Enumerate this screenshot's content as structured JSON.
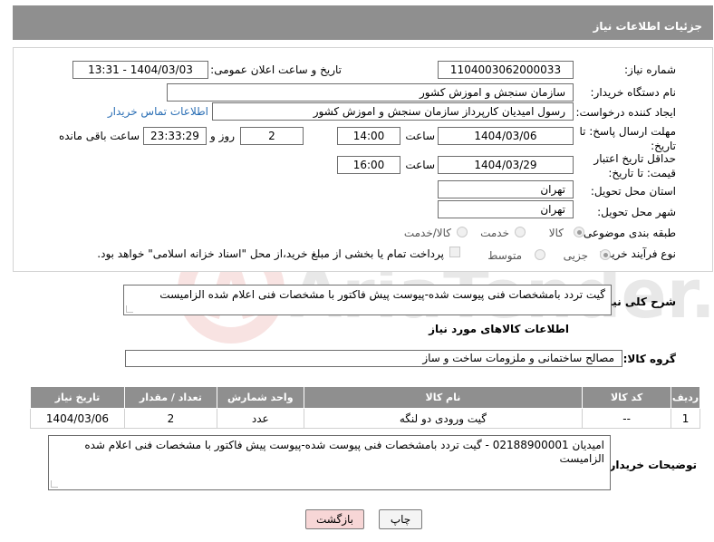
{
  "header": {
    "title": "جزئیات اطلاعات نیاز"
  },
  "form": {
    "need_number_label": "شماره نیاز:",
    "need_number": "1104003062000033",
    "announce_label": "تاریخ و ساعت اعلان عمومی:",
    "announce_value": "1404/03/03 - 13:31",
    "buyer_org_label": "نام دستگاه خریدار:",
    "buyer_org": "سازمان سنجش و اموزش کشور",
    "requester_label": "ایجاد کننده درخواست:",
    "requester": "رسول امیدیان کارپرداز سازمان سنجش و اموزش کشور",
    "contact_link": "اطلاعات تماس خریدار",
    "reply_deadline_label": "مهلت ارسال پاسخ: تا تاریخ:",
    "reply_date": "1404/03/06",
    "time_label": "ساعت",
    "reply_time": "14:00",
    "days_value": "2",
    "days_label": "روز و",
    "remaining_time": "23:33:29",
    "remaining_label": "ساعت باقی مانده",
    "price_validity_label": "حداقل تاریخ اعتبار قیمت: تا تاریخ:",
    "price_date": "1404/03/29",
    "price_time": "16:00",
    "province_label": "استان محل تحویل:",
    "province": "تهران",
    "city_label": "شهر محل تحویل:",
    "city": "تهران",
    "category_label": "طبقه بندی موضوعی:",
    "category_options": [
      "کالا",
      "خدمت",
      "کالا/خدمت"
    ],
    "category_selected": "کالا",
    "process_label": "نوع فرآیند خرید :",
    "process_options": [
      "جزیی",
      "متوسط"
    ],
    "process_selected": "جزیی",
    "payment_note": "پرداخت تمام یا بخشی از مبلغ خرید،از محل \"اسناد خزانه اسلامی\" خواهد بود."
  },
  "description": {
    "label": "شرح کلی نیاز:",
    "text": "گیت تردد بامشخصات فنی پیوست شده-پیوست پیش فاکتور با مشخصات فنی اعلام شده الزامیست"
  },
  "goods": {
    "section_title": "اطلاعات کالاهای مورد نیاز",
    "group_label": "گروه کالا:",
    "group_value": "مصالح ساختمانی و ملزومات ساخت و ساز",
    "columns": [
      "ردیف",
      "کد کالا",
      "نام کالا",
      "واحد شمارش",
      "تعداد / مقدار",
      "تاریخ نیاز"
    ],
    "rows": [
      {
        "row": "1",
        "code": "--",
        "name": "گیت ورودی دو لنگه",
        "unit": "عدد",
        "qty": "2",
        "date": "1404/03/06"
      }
    ]
  },
  "buyer_notes": {
    "label": "توضیحات خریدار:",
    "text": "امیدیان 02188900001 - گیت تردد بامشخصات فنی پیوست شده-پیوست پیش فاکتور با مشخصات فنی اعلام شده الزامیست"
  },
  "buttons": {
    "print": "چاپ",
    "back": "بازگشت"
  },
  "watermark_text": "AriaTender.net",
  "colors": {
    "header_bg": "#8f8f8f",
    "link": "#2b6fb5",
    "back_btn_bg": "#f7d6d6"
  }
}
